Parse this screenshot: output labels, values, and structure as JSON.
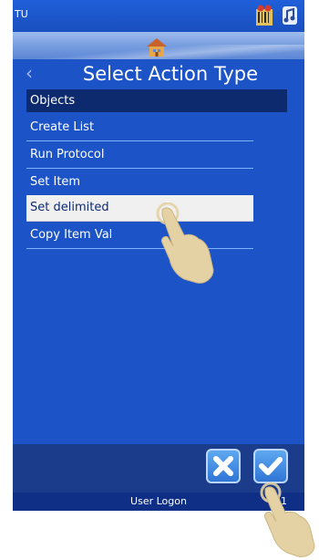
{
  "status": {
    "title": "TU"
  },
  "header": {
    "title": "Select Action Type",
    "back_icon": "chevron-left-icon",
    "home_icon": "home-icon"
  },
  "list": {
    "section": "Objects",
    "items": [
      {
        "label": "Create List",
        "selected": false
      },
      {
        "label": "Run Protocol",
        "selected": false
      },
      {
        "label": "Set Item",
        "selected": false
      },
      {
        "label": "Set delimited",
        "selected": true
      },
      {
        "label": "Copy Item Val",
        "selected": false
      }
    ]
  },
  "buttons": {
    "cancel_icon": "close-icon",
    "ok_icon": "checkmark-icon"
  },
  "footer": {
    "label": "User Logon",
    "right_text": "01"
  },
  "colors": {
    "screen_bg": "#1c54c8",
    "header_section": "#0d2a6e",
    "selected_bg": "#f0f0f0",
    "accent_line": "#7db3ff"
  }
}
